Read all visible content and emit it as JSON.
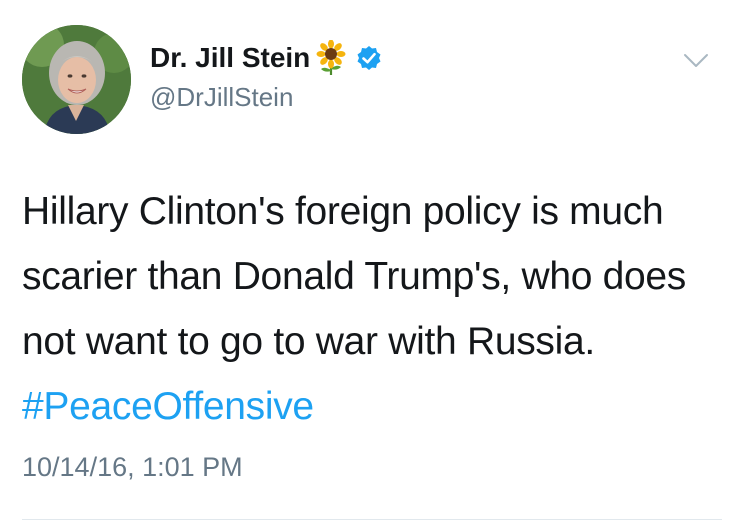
{
  "tweet": {
    "author": {
      "display_name": "Dr. Jill Stein",
      "handle": "@DrJillStein",
      "name_emoji": "sunflower",
      "verified": true
    },
    "text_parts": {
      "body": "Hillary Clinton's foreign policy is much scarier than Donald Trump's, who does not want to go to war with Russia.",
      "hashtag": "#PeaceOffensive"
    },
    "timestamp": "10/14/16, 1:01 PM",
    "icons": {
      "avatar": "profile-photo",
      "verified": "verified-badge-icon",
      "menu": "chevron-down-icon",
      "emoji": "sunflower-icon"
    },
    "colors": {
      "text": "#14171a",
      "secondary": "#657786",
      "link": "#1da1f2",
      "verified": "#1da1f2"
    }
  }
}
